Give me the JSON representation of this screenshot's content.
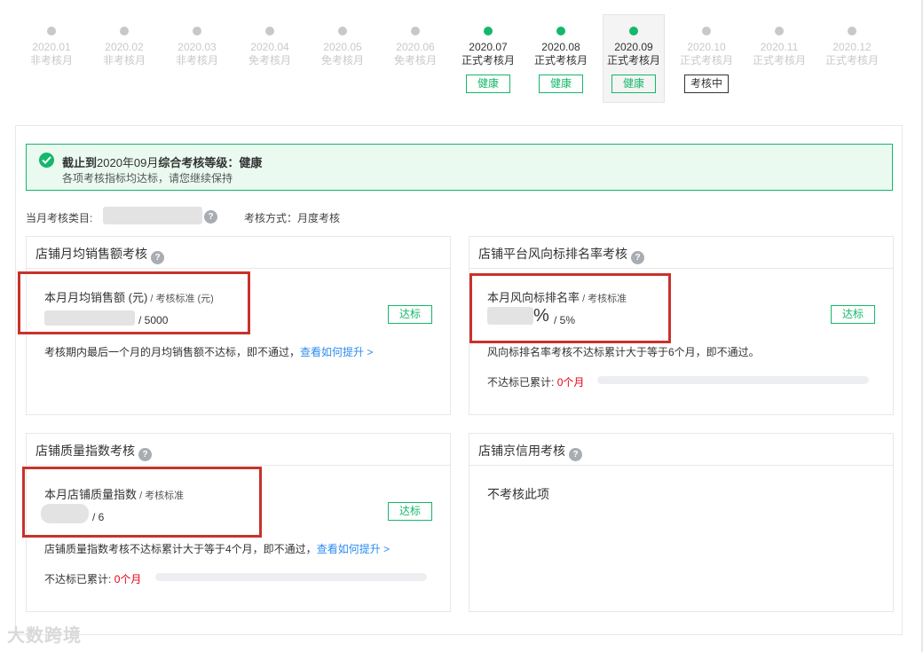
{
  "timeline": [
    {
      "date": "2020.01",
      "type": "非考核月",
      "active": false,
      "dot": "gray",
      "badge": ""
    },
    {
      "date": "2020.02",
      "type": "非考核月",
      "active": false,
      "dot": "gray",
      "badge": ""
    },
    {
      "date": "2020.03",
      "type": "非考核月",
      "active": false,
      "dot": "gray",
      "badge": ""
    },
    {
      "date": "2020.04",
      "type": "免考核月",
      "active": false,
      "dot": "gray",
      "badge": ""
    },
    {
      "date": "2020.05",
      "type": "免考核月",
      "active": false,
      "dot": "gray",
      "badge": ""
    },
    {
      "date": "2020.06",
      "type": "免考核月",
      "active": false,
      "dot": "gray",
      "badge": ""
    },
    {
      "date": "2020.07",
      "type": "正式考核月",
      "active": true,
      "dot": "green",
      "badge": "健康"
    },
    {
      "date": "2020.08",
      "type": "正式考核月",
      "active": true,
      "dot": "green",
      "badge": "健康"
    },
    {
      "date": "2020.09",
      "type": "正式考核月",
      "active": true,
      "dot": "green",
      "badge": "健康",
      "current": true
    },
    {
      "date": "2020.10",
      "type": "正式考核月",
      "active": false,
      "dot": "gray",
      "badge": "考核中"
    },
    {
      "date": "2020.11",
      "type": "正式考核月",
      "active": false,
      "dot": "gray",
      "badge": ""
    },
    {
      "date": "2020.12",
      "type": "正式考核月",
      "active": false,
      "dot": "gray",
      "badge": ""
    }
  ],
  "alert": {
    "title_prefix": "截止到",
    "title_month": "2020年09月",
    "title_suffix": "综合考核等级：健康",
    "subtitle": "各项考核指标均达标，请您继续保持"
  },
  "meta": {
    "category_label": "当月考核类目:",
    "method": "考核方式：月度考核"
  },
  "cards": {
    "sales": {
      "title": "店铺月均销售额考核",
      "label": "本月月均销售额 (元)",
      "label_small": " / 考核标准 (元)",
      "standard": "/ 5000",
      "tag": "达标",
      "desc": "考核期内最后一个月的月均销售额不达标，即不通过，",
      "link": "查看如何提升 >"
    },
    "rank": {
      "title": "店铺平台风向标排名率考核",
      "label": "本月风向标排名率",
      "label_small": " / 考核标准",
      "pct": "%",
      "standard": "/ 5%",
      "tag": "达标",
      "desc": "风向标排名率考核不达标累计大于等于6个月，即不通过。",
      "fail_label": "不达标已累计:",
      "fail_value": "0个月",
      "fail_progress": 0
    },
    "quality": {
      "title": "店铺质量指数考核",
      "label": "本月店铺质量指数",
      "label_small": " / 考核标准",
      "standard": "/ 6",
      "tag": "达标",
      "desc": "店铺质量指数考核不达标累计大于等于4个月，即不通过，",
      "link": "查看如何提升 >",
      "fail_label": "不达标已累计:",
      "fail_value": "0个月",
      "fail_progress": 0
    },
    "credit": {
      "title": "店铺京信用考核",
      "text": "不考核此项"
    }
  },
  "watermark": "大数跨境",
  "colors": {
    "green": "#15b76a",
    "red_box": "#c8322c",
    "link": "#2d8cf0",
    "fail_red": "#e60012"
  }
}
